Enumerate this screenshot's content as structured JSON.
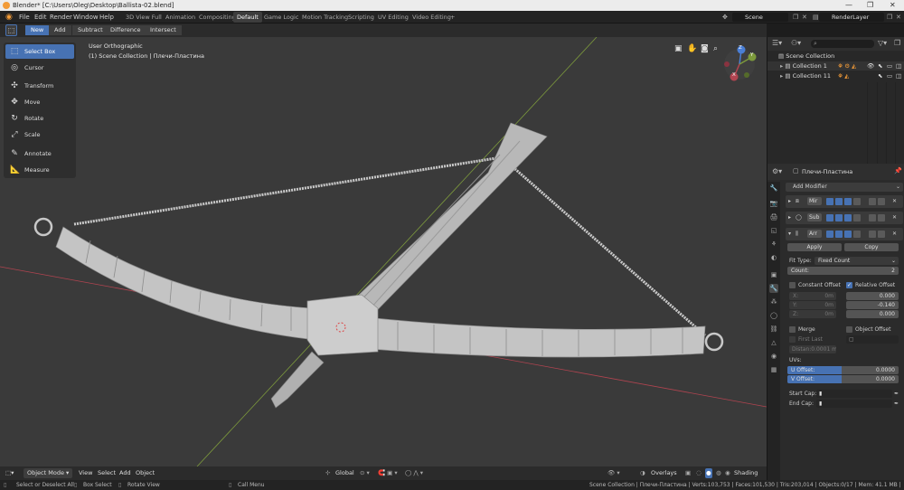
{
  "window": {
    "title": "Blender* [C:\\Users\\Oleg\\Desktop\\Ballista-02.blend]",
    "controls": [
      "—",
      "❐",
      "✕"
    ]
  },
  "menu": [
    "File",
    "Edit",
    "Render",
    "Window",
    "Help"
  ],
  "workspaces": [
    "3D View Full",
    "Animation",
    "Compositing",
    "Default",
    "Game Logic",
    "Motion Tracking",
    "Scripting",
    "UV Editing",
    "Video Editing",
    "+"
  ],
  "active_workspace": "Default",
  "scene": {
    "name": "Scene",
    "render_layer": "RenderLayer"
  },
  "tool_header": {
    "new": "New",
    "add": "Add",
    "subtract": "Subtract",
    "difference": "Difference",
    "intersect": "Intersect"
  },
  "toolbar": {
    "select_box": "Select Box",
    "cursor": "Cursor",
    "transform": "Transform",
    "move": "Move",
    "rotate": "Rotate",
    "scale": "Scale",
    "annotate": "Annotate",
    "measure": "Measure"
  },
  "viewport": {
    "view_name": "User Orthographic",
    "collection_path": "(1) Scene Collection | Плечи-Пластина"
  },
  "gizmo": {
    "z": "Z",
    "y": "Y",
    "x": "X"
  },
  "viewport_footer": {
    "mode": "Object Mode",
    "view": "View",
    "select": "Select",
    "add": "Add",
    "object": "Object",
    "orientation": "Global",
    "overlays": "Overlays",
    "shading": "Shading"
  },
  "status": {
    "left1": "Select or Deselect All",
    "left2": "Box Select",
    "left3": "Rotate View",
    "left4": "Call Menu",
    "right": "Scene Collection | Плечи-Пластина | Verts:103,753 | Faces:101,530 | Tris:203,014 | Objects:0/17 | Mem: 41.1 MB | v2.80.39"
  },
  "outliner": {
    "root": "Scene Collection",
    "items": [
      {
        "name": "Collection 1"
      },
      {
        "name": "Collection 11"
      }
    ]
  },
  "properties": {
    "object_name": "Плечи-Пластина",
    "add_modifier": "Add Modifier",
    "modifiers": [
      {
        "short": "Mir"
      },
      {
        "short": "Sub"
      },
      {
        "short": "Arr"
      }
    ],
    "apply": "Apply",
    "copy": "Copy",
    "fit_type_label": "Fit Type:",
    "fit_type": "Fixed Count",
    "count_label": "Count:",
    "count": "2",
    "constant_offset": "Constant Offset",
    "relative_offset": "Relative Offset",
    "const": {
      "x_label": "X:",
      "x": "0m",
      "y_label": "Y:",
      "y": "0m",
      "z_label": "Z:",
      "z": "0m"
    },
    "rel": {
      "x": "0.000",
      "y": "-0.140",
      "z": "0.000"
    },
    "merge": "Merge",
    "object_offset": "Object Offset",
    "first_last": "First Last",
    "distance": "Distan:0.0001 m",
    "uvs": "UVs:",
    "u_offset_label": "U Offset:",
    "u_offset": "0.0000",
    "v_offset_label": "V Offset:",
    "v_offset": "0.0000",
    "start_cap": "Start Cap:",
    "end_cap": "End Cap:"
  },
  "colors": {
    "accent": "#4772b3",
    "orange": "#f29b38",
    "viewport": "#3a3a3a",
    "axis_red": "#b14450",
    "axis_green": "#7d9a3c"
  }
}
